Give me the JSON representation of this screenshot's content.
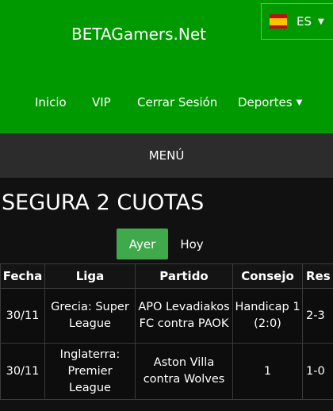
{
  "header": {
    "brand": "BETAGamers.Net",
    "language": {
      "code": "ES",
      "flag": "spain-flag-icon"
    }
  },
  "nav": {
    "items": [
      {
        "label": "Inicio"
      },
      {
        "label": "VIP"
      },
      {
        "label": "Cerrar Sesión"
      },
      {
        "label": "Deportes",
        "has_dropdown": true
      }
    ]
  },
  "menu_label": "MENÚ",
  "page_title": "SEGURA 2 CUOTAS",
  "tabs": [
    {
      "label": "Ayer",
      "active": true
    },
    {
      "label": "Hoy",
      "active": false
    }
  ],
  "table": {
    "headers": [
      "Fecha",
      "Liga",
      "Partido",
      "Consejo",
      "Res"
    ],
    "rows": [
      [
        "30/11",
        "Grecia: Super League",
        "APO Levadiakos FC contra PAOK",
        "Handicap 1 (2:0)",
        "2-3"
      ],
      [
        "30/11",
        "Inglaterra: Premier League",
        "Aston Villa contra Wolves",
        "1",
        "1-0"
      ]
    ]
  },
  "colors": {
    "header_bg": "#009a00",
    "menubar_bg": "#2c2c2c",
    "active_tab": "#3fa94b",
    "page_bg": "#111111"
  }
}
